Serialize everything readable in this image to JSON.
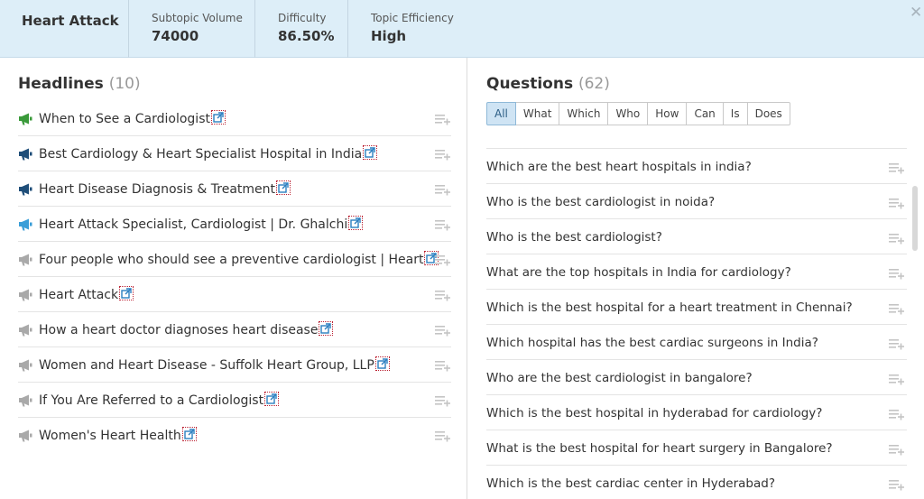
{
  "header": {
    "title": "Heart Attack",
    "stats": [
      {
        "label": "Subtopic Volume",
        "value": "74000"
      },
      {
        "label": "Difficulty",
        "value": "86.50%"
      },
      {
        "label": "Topic Efficiency",
        "value": "High"
      }
    ],
    "close_icon": "close-icon"
  },
  "headlines": {
    "title": "Headlines",
    "count": "(10)",
    "items": [
      {
        "text": "When to See a Cardiologist",
        "icon": "megaphone-green"
      },
      {
        "text": "Best Cardiology & Heart Specialist Hospital in India",
        "icon": "megaphone-dark-blue"
      },
      {
        "text": "Heart Disease Diagnosis & Treatment",
        "icon": "megaphone-dark-blue"
      },
      {
        "text": "Heart Attack Specialist, Cardiologist | Dr. Ghalchi",
        "icon": "megaphone-light-blue"
      },
      {
        "text": "Four people who should see a preventive cardiologist | Heart",
        "icon": "megaphone-gray"
      },
      {
        "text": "Heart Attack",
        "icon": "megaphone-gray"
      },
      {
        "text": "How a heart doctor diagnoses heart disease",
        "icon": "megaphone-gray"
      },
      {
        "text": "Women and Heart Disease - Suffolk Heart Group, LLP",
        "icon": "megaphone-gray"
      },
      {
        "text": "If You Are Referred to a Cardiologist",
        "icon": "megaphone-gray"
      },
      {
        "text": "Women's Heart Health",
        "icon": "megaphone-gray"
      }
    ]
  },
  "questions": {
    "title": "Questions",
    "count": "(62)",
    "filters": [
      "All",
      "What",
      "Which",
      "Who",
      "How",
      "Can",
      "Is",
      "Does"
    ],
    "active_filter": "All",
    "items": [
      "Which are the best heart hospitals in india?",
      "Who is the best cardiologist in noida?",
      "Who is the best cardiologist?",
      "What are the top hospitals in India for cardiology?",
      "Which is the best hospital for a heart treatment in Chennai?",
      "Which hospital has the best cardiac surgeons in India?",
      "Who are the best cardiologist in bangalore?",
      "Which is the best hospital in hyderabad for cardiology?",
      "What is the best hospital for heart surgery in Bangalore?",
      "Which is the best cardiac center in Hyderabad?"
    ]
  },
  "colors": {
    "header_bg": "#ddeef8",
    "megaphone_green": "#3a9a3a",
    "megaphone_dark_blue": "#1f4e79",
    "megaphone_light_blue": "#3a9ed8",
    "megaphone_gray": "#a9a9a9",
    "active_filter_bg": "#cfe4f4",
    "link_icon": "#2a7fc0"
  }
}
